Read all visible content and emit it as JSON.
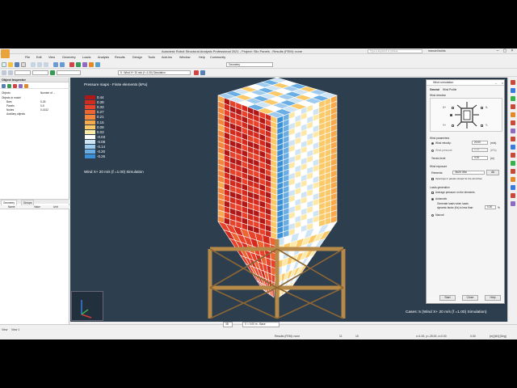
{
  "window": {
    "title": "Autodesk Robot Structural Analysis Professional 2021 - Project: Silo Panels - Results (FEM): none",
    "search_placeholder": "Type a keyword or phrase",
    "user": "manuel.builds"
  },
  "menu": [
    "File",
    "Edit",
    "View",
    "Geometry",
    "Loads",
    "Analysis",
    "Results",
    "Design",
    "Tools",
    "Add-Ins",
    "Window",
    "Help",
    "Community"
  ],
  "toolbar": {
    "layout_combo": "Geometry",
    "case_combo": "5 : Wind X+ 20 m/s (f =1.00) Simulation"
  },
  "object_inspector": {
    "title": "Object Inspector",
    "col_objects": "Objects",
    "col_number": "Number of ...",
    "tree": [
      {
        "label": "Objects in model",
        "count": ""
      },
      {
        "label": "Bars",
        "count": "0-26"
      },
      {
        "label": "Panels",
        "count": "0-5"
      },
      {
        "label": "Nodes",
        "count": "0-1612"
      },
      {
        "label": "Auxiliary objects",
        "count": ""
      }
    ],
    "tabs": [
      "Geometry",
      "Groups"
    ],
    "prop_cols": [
      "Name",
      "Value",
      "Unit"
    ]
  },
  "viewport": {
    "legend_title": "Pressure maps - Finite elements (kPa)",
    "legend": [
      {
        "value": "0.44",
        "color": "#b01818"
      },
      {
        "value": "0.39",
        "color": "#d42a1e"
      },
      {
        "value": "0.33",
        "color": "#e8432a"
      },
      {
        "value": "0.27",
        "color": "#ef6532"
      },
      {
        "value": "0.21",
        "color": "#f5873c"
      },
      {
        "value": "0.15",
        "color": "#f8a94c"
      },
      {
        "value": "0.09",
        "color": "#fbc967"
      },
      {
        "value": "0.03",
        "color": "#fde8a6"
      },
      {
        "value": "-0.03",
        "color": "#ffffff"
      },
      {
        "value": "-0.08",
        "color": "#cfe4f5"
      },
      {
        "value": "-0.14",
        "color": "#9ecbee"
      },
      {
        "value": "-0.20",
        "color": "#6aaee4"
      },
      {
        "value": "-0.26",
        "color": "#3b8fd6"
      }
    ],
    "legend_caption": "Wind X+ 20 m/s (f =1.00) Simulation",
    "cases_label": "Cases: 5 (Wind X+ 20 m/s (f =1.00) Simulation)",
    "view_mode": "3D",
    "coord": "X = 0.00 m - Base"
  },
  "wind_dialog": {
    "title": "Wind simulation",
    "tabs": [
      "General",
      "Wind Profile"
    ],
    "wind_direction_label": "Wind direction",
    "dir_x_plus": "X+",
    "dir_x_minus": "X-",
    "dir_y_plus": "Y+",
    "dir_y_minus": "Y-",
    "wind_params_label": "Wind parameters",
    "wind_velocity_label": "Wind velocity:",
    "wind_velocity_value": "20.00",
    "wind_velocity_unit": "(m/s)",
    "wind_pressure_label": "Wind pressure:",
    "wind_pressure_value": "0.25",
    "wind_pressure_unit": "(kPa)",
    "terrain_label": "Terrain level:",
    "terrain_value": "0.00",
    "terrain_unit": "(m)",
    "wind_exposure_label": "Wind exposure",
    "elements_label": "Elements:",
    "elements_value": "3to25 30to",
    "all_button": "All",
    "openings_label": "Openings in panels closed for the wind flow",
    "loads_gen_label": "Loads generation",
    "avg_pressure_label": "Average pressure on the elements",
    "automatic_label": "Automatic",
    "generate_label": "Generate loads when loads",
    "dynamic_factor_label": "dynamic factor (Ks) is less than:",
    "dynamic_factor_value": "0.30",
    "dynamic_factor_unit": "%",
    "manual_label": "Manual",
    "start_button": "Start",
    "close_button": "Close",
    "help_button": "Help"
  },
  "view_tabs": [
    "View",
    "View 1"
  ],
  "status": {
    "results": "Results (FEM): none",
    "num_a": "11",
    "num_b": "15",
    "coords": "x=1.00, y=-25.00, z=0.00",
    "angle": "0.00",
    "units": "[m] [kN] [Deg]"
  }
}
